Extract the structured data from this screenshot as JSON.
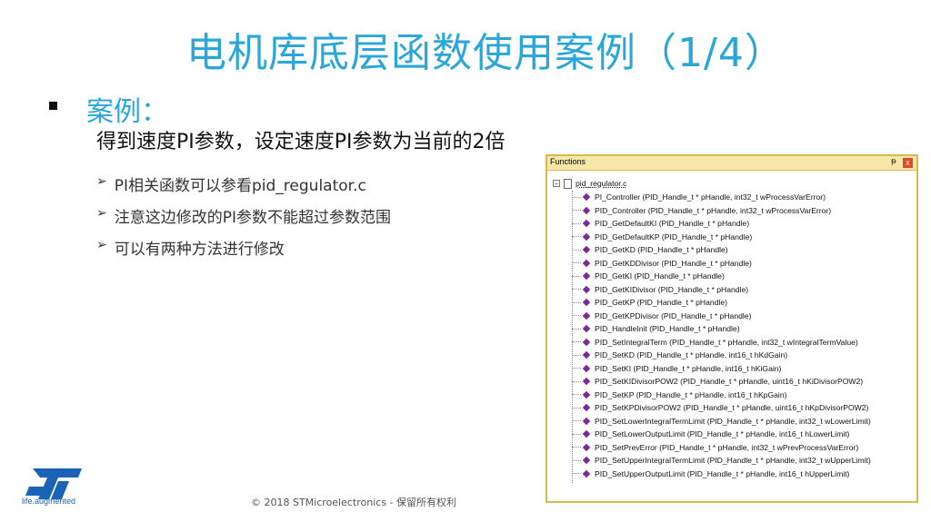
{
  "slide": {
    "title": "电机库底层函数使用案例（1/4）",
    "case_label": "案例：",
    "subline": "得到速度PI参数，设定速度PI参数为当前的2倍",
    "items": [
      "PI相关函数可以参看pid_regulator.c",
      "注意这边修改的PI参数不能超过参数范围",
      "可以有两种方法进行修改"
    ],
    "footer": "© 2018 STMicroelectronics - 保留所有权利",
    "logo_tag": "life.augmented"
  },
  "panel": {
    "title": "Functions",
    "pin_glyph": "ᵽ",
    "close_glyph": "x",
    "file": "pid_regulator.c",
    "functions": [
      "PI_Controller (PID_Handle_t * pHandle, int32_t wProcessVarError)",
      "PID_Controller (PID_Handle_t * pHandle, int32_t wProcessVarError)",
      "PID_GetDefaultKI (PID_Handle_t * pHandle)",
      "PID_GetDefaultKP (PID_Handle_t * pHandle)",
      "PID_GetKD (PID_Handle_t * pHandle)",
      "PID_GetKDDivisor (PID_Handle_t * pHandle)",
      "PID_GetKI (PID_Handle_t * pHandle)",
      "PID_GetKIDivisor (PID_Handle_t * pHandle)",
      "PID_GetKP (PID_Handle_t * pHandle)",
      "PID_GetKPDivisor (PID_Handle_t * pHandle)",
      "PID_HandleInit (PID_Handle_t * pHandle)",
      "PID_SetIntegralTerm (PID_Handle_t * pHandle, int32_t wIntegralTermValue)",
      "PID_SetKD (PID_Handle_t * pHandle, int16_t hKdGain)",
      "PID_SetKI (PID_Handle_t * pHandle, int16_t hKiGain)",
      "PID_SetKIDivisorPOW2 (PID_Handle_t * pHandle, uint16_t hKiDivisorPOW2)",
      "PID_SetKP (PID_Handle_t * pHandle, int16_t hKpGain)",
      "PID_SetKPDivisorPOW2 (PID_Handle_t * pHandle, uint16_t hKpDivisorPOW2)",
      "PID_SetLowerIntegralTermLimit (PID_Handle_t * pHandle, int32_t wLowerLimit)",
      "PID_SetLowerOutputLimit (PID_Handle_t * pHandle, int16_t hLowerLimit)",
      "PID_SetPrevError (PID_Handle_t * pHandle, int32_t wPrevProcessVarError)",
      "PID_SetUpperIntegralTermLimit (PID_Handle_t * pHandle, int32_t wUpperLimit)",
      "PID_SetUpperOutputLimit (PID_Handle_t * pHandle, int16_t hUpperLimit)"
    ]
  },
  "colors": {
    "title": "#2aa6d9",
    "panel_border": "#d9b84e",
    "function_icon": "#7a2a9a",
    "logo": "#1a63b5"
  }
}
